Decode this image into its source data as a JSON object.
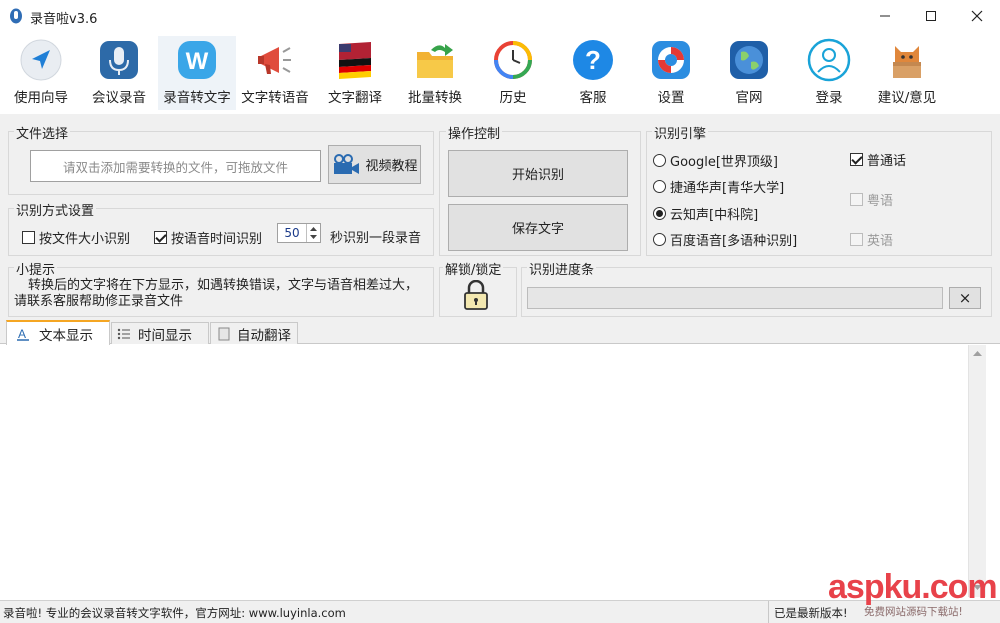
{
  "window": {
    "title": "录音啦v3.6"
  },
  "toolbar": [
    {
      "label": "使用向导",
      "icon": "navigation-arrow-icon"
    },
    {
      "label": "会议录音",
      "icon": "microphone-icon"
    },
    {
      "label": "录音转文字",
      "icon": "w-badge-icon"
    },
    {
      "label": "文字转语音",
      "icon": "megaphone-icon"
    },
    {
      "label": "文字翻译",
      "icon": "flags-icon"
    },
    {
      "label": "批量转换",
      "icon": "folder-arrow-icon"
    },
    {
      "label": "历史",
      "icon": "history-clock-icon"
    },
    {
      "label": "客服",
      "icon": "help-question-icon"
    },
    {
      "label": "设置",
      "icon": "lifebuoy-icon"
    },
    {
      "label": "官网",
      "icon": "globe-icon"
    },
    {
      "label": "登录",
      "icon": "user-icon"
    },
    {
      "label": "建议/意见",
      "icon": "cat-box-icon"
    }
  ],
  "file_select": {
    "group_label": "文件选择",
    "placeholder": "请双击添加需要转换的文件，可拖放文件",
    "video_button": "视频教程"
  },
  "mode": {
    "group_label": "识别方式设置",
    "by_size_label": "按文件大小识别",
    "by_size_checked": false,
    "by_time_label": "按语音时间识别",
    "by_time_checked": true,
    "seconds_value": "50",
    "seconds_suffix": "秒识别一段录音"
  },
  "operation": {
    "group_label": "操作控制",
    "start_button": "开始识别",
    "save_button": "保存文字"
  },
  "engine": {
    "group_label": "识别引擎",
    "options": [
      {
        "label": "Google[世界顶级]",
        "checked": false
      },
      {
        "label": "捷通华声[青华大学]",
        "checked": false
      },
      {
        "label": "云知声[中科院]",
        "checked": true
      },
      {
        "label": "百度语音[多语种识别]",
        "checked": false
      }
    ],
    "languages": [
      {
        "label": "普通话",
        "checked": true,
        "enabled": true
      },
      {
        "label": "粤语",
        "checked": false,
        "enabled": false
      },
      {
        "label": "英语",
        "checked": false,
        "enabled": false
      }
    ]
  },
  "tips": {
    "group_label": "小提示",
    "text": "转换后的文字将在下方显示，如遇转换错误，文字与语音相差过大，请联系客服帮助修正录音文件"
  },
  "lock": {
    "group_label": "解锁/锁定"
  },
  "progress": {
    "group_label": "识别进度条",
    "value": 0,
    "cancel_label": "×"
  },
  "tabs": [
    {
      "label": "文本显示",
      "active": true
    },
    {
      "label": "时间显示",
      "active": false
    },
    {
      "label": "自动翻译",
      "active": false
    }
  ],
  "status": {
    "left": "录音啦! 专业的会议录音转文字软件，官方网址: www.luyinla.com",
    "right": "已是最新版本!"
  },
  "watermark": {
    "brand": "aspku.com",
    "sub": "免费网站源码下载站!"
  }
}
